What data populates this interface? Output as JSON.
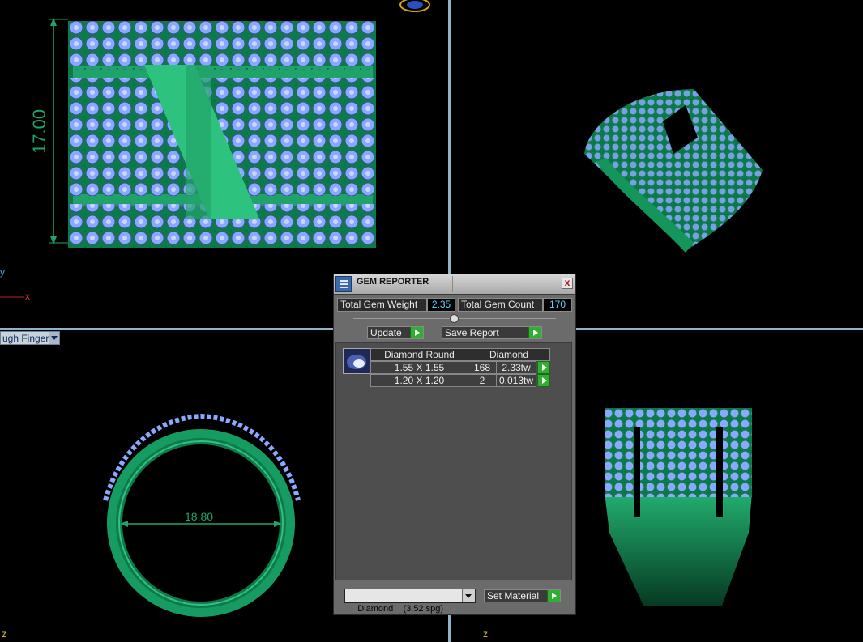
{
  "top_view": {
    "dimension": "17.00",
    "axis_y": "y",
    "axis_x": "x"
  },
  "finger_dropdown": {
    "value": "ugh Finger"
  },
  "front_view": {
    "dimension": "18.80",
    "axis_z": "z"
  },
  "side_view": {
    "axis_z": "z"
  },
  "gem_reporter": {
    "title": "GEM REPORTER",
    "close": "x",
    "total_weight_label": "Total Gem Weight",
    "total_weight": "2.35",
    "total_count_label": "Total Gem Count",
    "total_count": "170",
    "update_label": "Update",
    "save_label": "Save Report",
    "table": {
      "headers": [
        "Diamond Round",
        "Diamond"
      ],
      "rows": [
        {
          "size": "1.55 X 1.55",
          "count": "168",
          "weight": "2.33tw"
        },
        {
          "size": "1.20 X 1.20",
          "count": "2",
          "weight": "0.013tw"
        }
      ]
    },
    "material_value": "Diamond    (3.52 spg)",
    "set_material_label": "Set Material"
  },
  "colors": {
    "metal": "#1fa36a",
    "gem": "#8aa8ff",
    "panel": "#6b6b6b",
    "divider": "#8fb3c9"
  }
}
